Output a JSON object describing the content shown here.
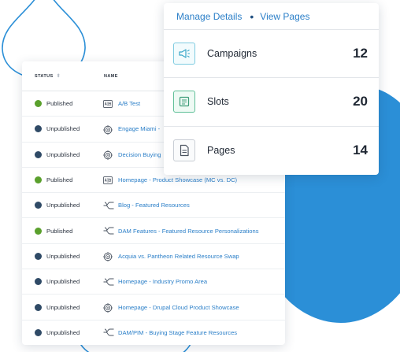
{
  "colors": {
    "accent": "#2b7fc8",
    "blob": "#2b8fd7",
    "published": "#5aa02c",
    "unpublished": "#2f4a66"
  },
  "details": {
    "manage_label": "Manage Details",
    "view_label": "View Pages",
    "metrics": [
      {
        "label": "Campaigns",
        "value": "12",
        "icon": "megaphone-icon"
      },
      {
        "label": "Slots",
        "value": "20",
        "icon": "slots-icon"
      },
      {
        "label": "Pages",
        "value": "14",
        "icon": "page-icon"
      }
    ]
  },
  "table": {
    "headers": {
      "status": "STATUS",
      "name": "NAME"
    },
    "rows": [
      {
        "status": "Published",
        "state": "published",
        "icon": "ab-test-icon",
        "name": "A/B Test"
      },
      {
        "status": "Unpublished",
        "state": "unpublished",
        "icon": "target-icon",
        "name": "Engage Miami -"
      },
      {
        "status": "Unpublished",
        "state": "unpublished",
        "icon": "target-icon",
        "name": "Decision Buying"
      },
      {
        "status": "Published",
        "state": "published",
        "icon": "ab-test-icon",
        "name": "Homepage - Product Showcase (MC vs. DC)"
      },
      {
        "status": "Unpublished",
        "state": "unpublished",
        "icon": "split-icon",
        "name": "Blog - Featured Resources"
      },
      {
        "status": "Published",
        "state": "published",
        "icon": "split-icon",
        "name": "DAM Features - Featured Resource Personalizations"
      },
      {
        "status": "Unpublished",
        "state": "unpublished",
        "icon": "target-icon",
        "name": "Acquia vs. Pantheon Related Resource Swap"
      },
      {
        "status": "Unpublished",
        "state": "unpublished",
        "icon": "split-icon",
        "name": "Homepage - Industry Promo Area"
      },
      {
        "status": "Unpublished",
        "state": "unpublished",
        "icon": "target-icon",
        "name": "Homepage - Drupal Cloud Product Showcase"
      },
      {
        "status": "Unpublished",
        "state": "unpublished",
        "icon": "split-icon",
        "name": "DAM/PIM - Buying Stage Feature Resources"
      }
    ]
  }
}
